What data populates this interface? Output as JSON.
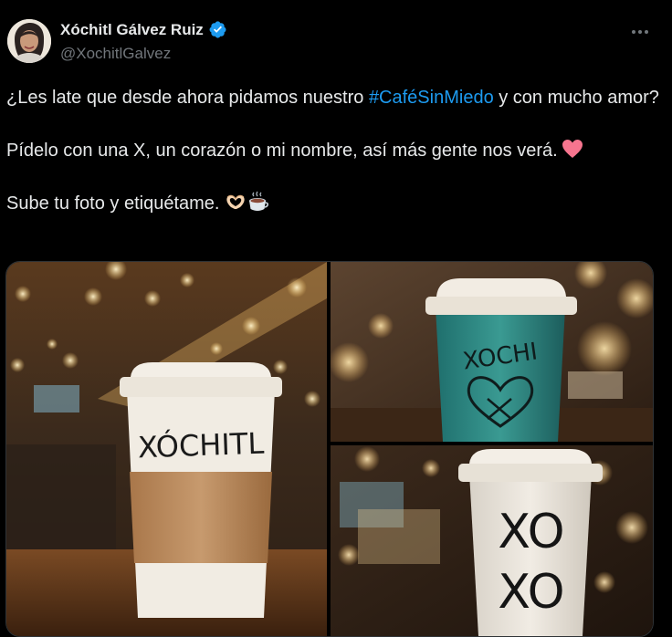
{
  "author": {
    "name": "Xóchitl Gálvez Ruiz",
    "handle": "@XochitlGalvez",
    "verified": true
  },
  "tweet": {
    "line1_before": "¿Les late que desde ahora pidamos nuestro ",
    "hashtag": "#CaféSinMiedo",
    "line1_after": " y con mucho amor?",
    "line2": "Pídelo con una X, un corazón o mi nombre, así más gente nos verá.",
    "line3": "Sube tu foto y etiquétame.",
    "emojis": [
      "heart-emoji",
      "heart-hands-emoji",
      "hot-beverage-emoji"
    ]
  },
  "media": {
    "cup1_text": "XÓCHITL",
    "cup2_text": "XOCHI",
    "cup3_line1": "XO",
    "cup3_line2": "XO"
  },
  "colors": {
    "background": "#000000",
    "text": "#e7e9ea",
    "muted": "#71767b",
    "link": "#1d9bf0",
    "verified": "#1d9bf0",
    "heart": "#f7758f"
  }
}
